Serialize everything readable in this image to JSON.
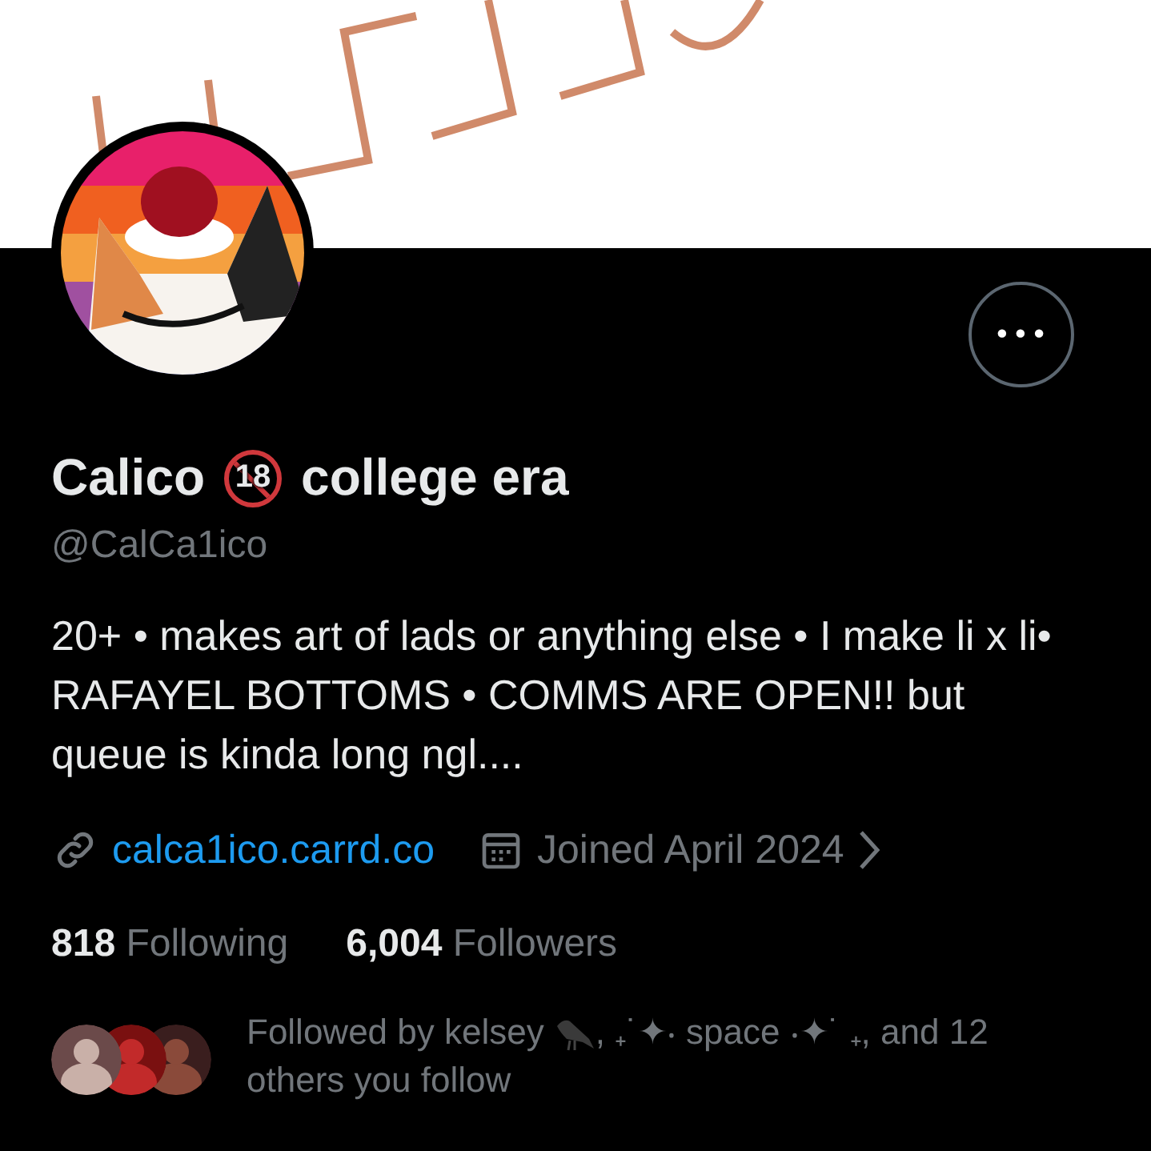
{
  "more_button": {
    "label": "•••"
  },
  "profile": {
    "name_start": "Calico",
    "name_badge": "18",
    "name_end": "college era",
    "handle": "@CalCa1ico",
    "bio": "20+ • makes art of lads or anything else • I make li x li• RAFAYEL BOTTOMS • COMMS ARE OPEN!! but queue is kinda long ngl....",
    "link": "calca1ico.carrd.co",
    "joined": "Joined April 2024"
  },
  "stats": [
    {
      "count": "818",
      "label": "Following"
    },
    {
      "count": "6,004",
      "label": "Followers"
    }
  ],
  "followed_by": {
    "text_start": "Followed by kelsey",
    "text_end": ", ₊˙✦‧ space ‧✦˙ ₊, and 12",
    "text_line_2": "others you follow"
  }
}
